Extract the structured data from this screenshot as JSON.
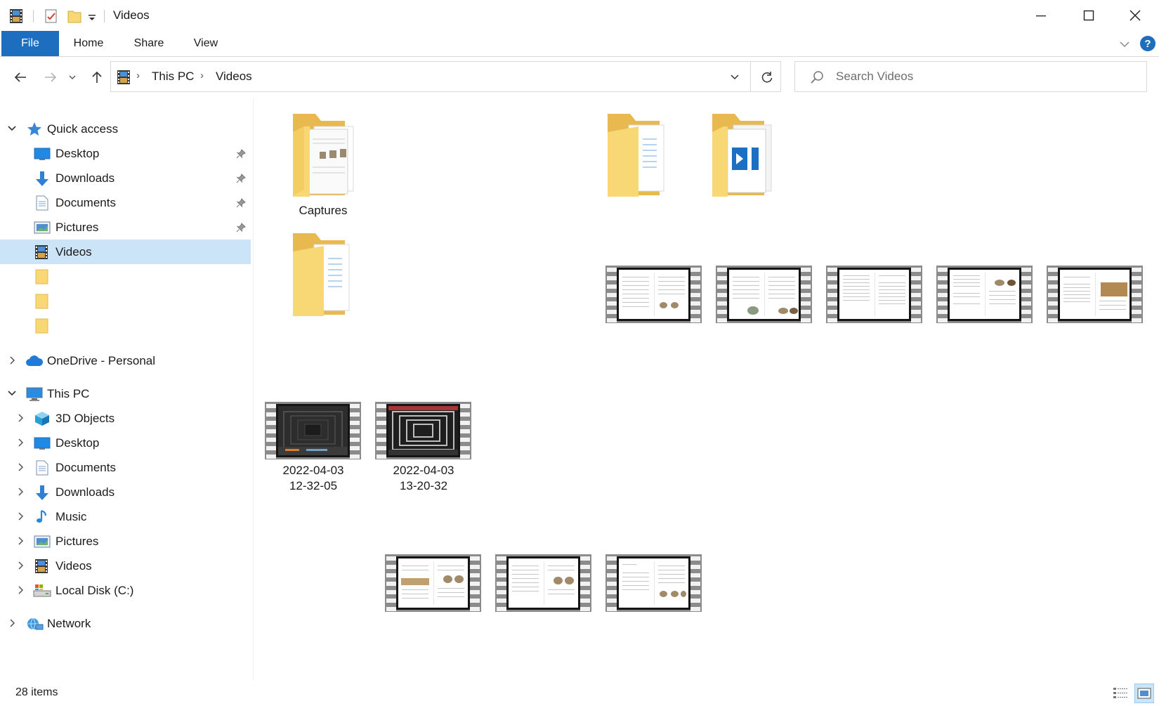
{
  "window": {
    "title": "Videos",
    "quick_access_toolbar": [
      "properties-icon",
      "new-folder-icon",
      "customize-qat-icon"
    ]
  },
  "ribbon": {
    "tabs": [
      {
        "label": "File"
      },
      {
        "label": "Home"
      },
      {
        "label": "Share"
      },
      {
        "label": "View"
      }
    ]
  },
  "address": {
    "breadcrumb": [
      "This PC",
      "Videos"
    ],
    "search_placeholder": "Search Videos"
  },
  "nav": {
    "quick_access": {
      "label": "Quick access",
      "items": [
        {
          "label": "Desktop",
          "icon": "desktop-icon",
          "pinned": true
        },
        {
          "label": "Downloads",
          "icon": "downloads-icon",
          "pinned": true
        },
        {
          "label": "Documents",
          "icon": "documents-icon",
          "pinned": true
        },
        {
          "label": "Pictures",
          "icon": "pictures-icon",
          "pinned": true
        },
        {
          "label": "Videos",
          "icon": "videos-icon",
          "pinned": false,
          "selected": true
        },
        {
          "label": "",
          "icon": "folder-icon"
        },
        {
          "label": "",
          "icon": "folder-icon"
        },
        {
          "label": "",
          "icon": "folder-icon"
        }
      ]
    },
    "onedrive": {
      "label": "OneDrive - Personal"
    },
    "this_pc": {
      "label": "This PC",
      "items": [
        {
          "label": "3D Objects",
          "icon": "3d-objects-icon"
        },
        {
          "label": "Desktop",
          "icon": "desktop-icon"
        },
        {
          "label": "Documents",
          "icon": "documents-icon"
        },
        {
          "label": "Downloads",
          "icon": "downloads-icon"
        },
        {
          "label": "Music",
          "icon": "music-icon"
        },
        {
          "label": "Pictures",
          "icon": "pictures-icon"
        },
        {
          "label": "Videos",
          "icon": "videos-icon"
        },
        {
          "label": "Local Disk (C:)",
          "icon": "local-disk-icon"
        }
      ]
    },
    "network": {
      "label": "Network"
    }
  },
  "content": {
    "folders": [
      {
        "label": "Captures"
      },
      {
        "label": ""
      },
      {
        "label": ""
      },
      {
        "label": ""
      }
    ],
    "videos": [
      {
        "label": "2022-04-03\n12-32-05"
      },
      {
        "label": "2022-04-03\n13-20-32"
      }
    ]
  },
  "status": {
    "item_count": "28 items",
    "views": [
      "details-view-icon",
      "large-icons-view-icon"
    ]
  },
  "colors": {
    "accent": "#1e6ec0",
    "selection": "#cce4f7",
    "folder": "#f8d775"
  }
}
